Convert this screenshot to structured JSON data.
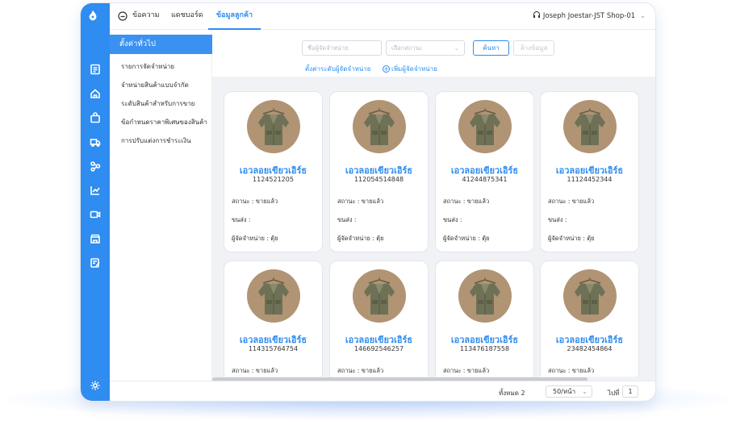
{
  "app": {
    "brand_color": "#2f8cf0"
  },
  "topbar": {
    "tabs": [
      {
        "label": "ข้อความ"
      },
      {
        "label": "แดชบอร์ด"
      },
      {
        "label": "ข้อมูลลูกค้า"
      }
    ],
    "user": "Joseph Joestar-JST Shop-01"
  },
  "sidebar": {
    "active": "ตั้งค่าทั่วไป",
    "items": [
      "รายการจัดจำหน่าย",
      "จำหน่ายสินค้าแบบจำกัด",
      "ระดับสินค้าสำหรับการขาย",
      "ข้อกำหนดราคาพิเศษของสินค้า",
      "การปรับแต่งการชำระเงิน"
    ]
  },
  "filters": {
    "distributor_placeholder": "ชื่อผู้จัดจำหน่าย",
    "status_placeholder": "เลือกสถานะ",
    "search_label": "ค้นหา",
    "clear_label": "ล้างข้อมูล",
    "level_link": "ตั้งค่าระดับผู้จัดจำหน่าย",
    "add_link": "เพิ่มผู้จัดจำหน่าย"
  },
  "card_labels": {
    "status": "สถานะ : ขายแล้ว",
    "shipping": "ขนส่ง :",
    "distributor": "ผู้จัดจำหน่าย : ตุ้ย"
  },
  "cards": [
    {
      "name": "เอวลอยเขียวเอิร์ธ",
      "id": "1124521205"
    },
    {
      "name": "เอวลอยเขียวเอิร์ธ",
      "id": "112054514848"
    },
    {
      "name": "เอวลอยเขียวเอิร์ธ",
      "id": "41244875341"
    },
    {
      "name": "เอวลอยเขียวเอิร์ธ",
      "id": "11124452344"
    },
    {
      "name": "เอวลอยเขียวเอิร์ธ",
      "id": "114315764754"
    },
    {
      "name": "เอวลอยเขียวเอิร์ธ",
      "id": "146692546257"
    },
    {
      "name": "เอวลอยเขียวเอิร์ธ",
      "id": "113476187558"
    },
    {
      "name": "เอวลอยเขียวเอิร์ธ",
      "id": "23482454864"
    }
  ],
  "footer": {
    "total": "ทั้งหมด 2",
    "page_size": "50/หน้า",
    "goto_label": "ไปที่",
    "page": "1"
  }
}
